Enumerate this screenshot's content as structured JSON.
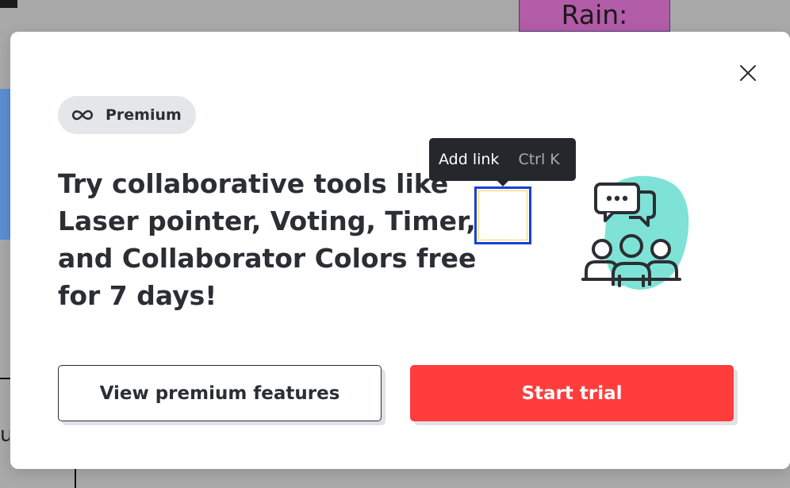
{
  "background": {
    "sticky_note_text": "Rain:",
    "edge_text": "ua"
  },
  "modal": {
    "badge": {
      "icon": "infinity-icon",
      "label": "Premium"
    },
    "headline": "Try collaborative tools like Laser pointer, Voting, Timer, and Collaborator Colors free for 7 days!",
    "illustration_icon": "collaborators-chat-icon",
    "close_icon": "close-icon",
    "secondary_button_label": "View premium features",
    "primary_button_label": "Start trial"
  },
  "tooltip": {
    "label": "Add link",
    "shortcut": "Ctrl K"
  },
  "colors": {
    "primary": "#ff3d3d",
    "badge_bg": "#e4e6ea",
    "text": "#2b2e33",
    "illustration_blob": "#7ee3d6",
    "selection": "#1a3fd6",
    "tooltip_bg": "#24272c"
  }
}
